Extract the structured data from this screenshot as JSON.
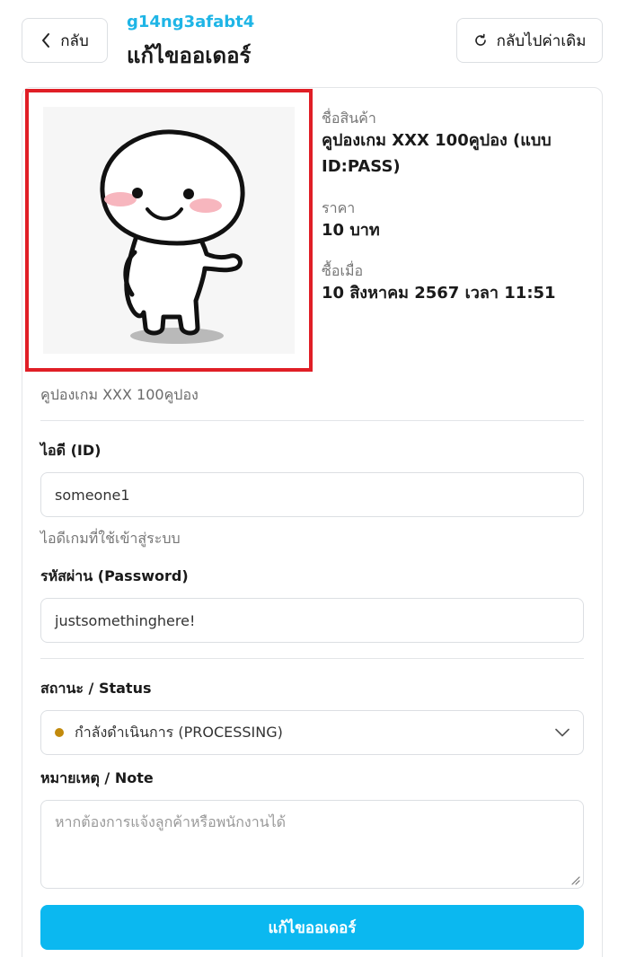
{
  "header": {
    "back_label": "กลับ",
    "order_code": "g14ng3afabt4",
    "title": "แก้ไขออเดอร์",
    "reset_label": "กลับไปค่าเดิม"
  },
  "product": {
    "name_label": "ชื่อสินค้า",
    "name_value": "คูปองเกม XXX 100คูปอง (แบบ ID:PASS)",
    "price_label": "ราคา",
    "price_value": "10 บาท",
    "purchased_label": "ซื้อเมื่อ",
    "purchased_value": "10 สิงหาคม 2567 เวลา 11:51",
    "subtitle": "คูปองเกม XXX 100คูปอง"
  },
  "form": {
    "id_label": "ไอดี (ID)",
    "id_value": "someone1",
    "id_helper": "ไอดีเกมที่ใช้เข้าสู่ระบบ",
    "password_label": "รหัสผ่าน (Password)",
    "password_value": "justsomethinghere!",
    "status_label": "สถานะ / Status",
    "status_value": "กำลังดำเนินการ (PROCESSING)",
    "status_color": "#c28a0c",
    "note_label": "หมายเหตุ / Note",
    "note_placeholder": "หากต้องการแจ้งลูกค้าหรือพนักงานได้",
    "submit_label": "แก้ไขออเดอร์"
  },
  "colors": {
    "accent": "#0bb8f0",
    "order_code": "#1fb5e6",
    "image_highlight": "#e01e26"
  },
  "icons": [
    "chevron-left-icon",
    "refresh-icon",
    "chevron-down-icon",
    "resize-grip-icon"
  ]
}
